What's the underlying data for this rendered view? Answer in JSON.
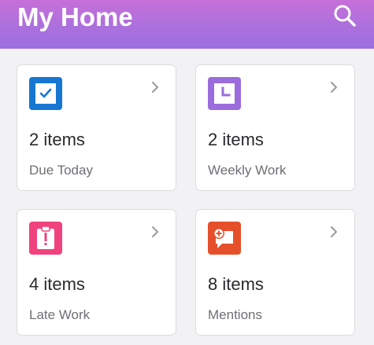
{
  "header": {
    "title": "My Home",
    "search_icon": "search-icon",
    "gradient": [
      "#c66fd8",
      "#9b6fe0"
    ]
  },
  "cards": [
    {
      "id": "due-today",
      "count": "2 items",
      "label": "Due Today",
      "icon": "checkbox-icon",
      "color": "#1677d2"
    },
    {
      "id": "weekly-work",
      "count": "2 items",
      "label": "Weekly Work",
      "icon": "clock-icon",
      "color": "#9a6cdc"
    },
    {
      "id": "late-work",
      "count": "4 items",
      "label": "Late Work",
      "icon": "alert-icon",
      "color": "#f0427d"
    },
    {
      "id": "mentions",
      "count": "8 items",
      "label": "Mentions",
      "icon": "mention-bubble-icon",
      "color": "#e5502a"
    }
  ]
}
